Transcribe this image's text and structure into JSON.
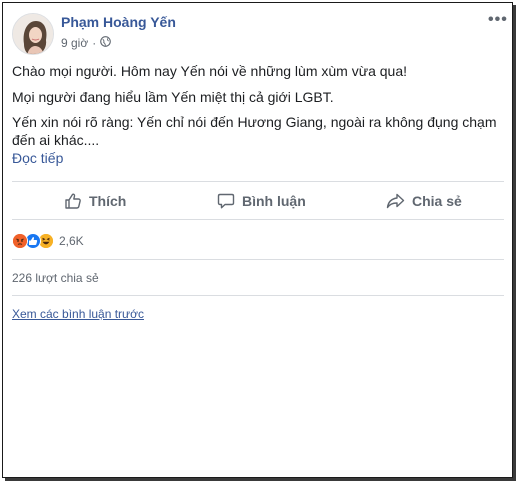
{
  "post": {
    "author": "Phạm Hoàng Yến",
    "time": "9 giờ",
    "privacy_icon": "globe-icon",
    "more_glyph": "•••",
    "lines": [
      "Chào mọi người. Hôm nay Yến nói về những lùm xùm vừa qua!",
      "Mọi người đang hiểu lầm Yến miệt thị cả giới LGBT.",
      "Yến xin nói rõ ràng: Yến chỉ nói đến Hương Giang, ngoài ra không đụng chạm",
      "đến ai khác...."
    ],
    "read_more": "Đọc tiếp"
  },
  "actions": {
    "like": "Thích",
    "comment": "Bình luận",
    "share": "Chia sẻ"
  },
  "reactions": {
    "icons": [
      "angry-icon",
      "like-icon",
      "haha-icon"
    ],
    "count": "2,6K"
  },
  "shares": "226 lượt chia sẻ",
  "previous_comments": "Xem các bình luận trước",
  "colors": {
    "link": "#385898",
    "muted": "#606770",
    "like_blue": "#1877f2",
    "angry": "#f0612a",
    "haha": "#f7b125"
  }
}
